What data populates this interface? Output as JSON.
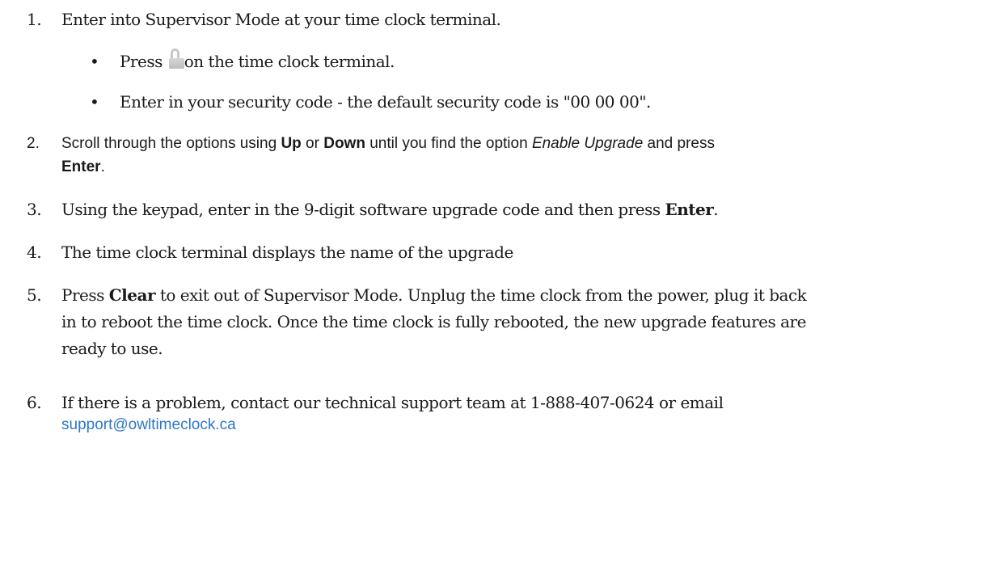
{
  "steps": [
    {
      "number": "1.",
      "text": "Enter into Supervisor Mode at your time clock terminal.",
      "bullets": [
        {
          "marker": "•",
          "before": "Press ",
          "icon": "lock-icon",
          "after": "on the time clock terminal."
        },
        {
          "marker": "•",
          "text": "Enter in your security code - the default security code is \"00 00 00\"."
        }
      ]
    },
    {
      "number": "2.",
      "t1": "Scroll through the options using ",
      "b1": "Up",
      "t2": " or ",
      "b2": "Down",
      "t3": " until you find the option ",
      "i1": "Enable Upgrade",
      "t4": " and press",
      "b3": "Enter",
      "t5": "."
    },
    {
      "number": "3.",
      "t1": "Using the keypad, enter in the 9-digit software upgrade code and then press ",
      "b1": "Enter",
      "t2": "."
    },
    {
      "number": "4.",
      "text": "The time clock terminal displays the name of the upgrade"
    },
    {
      "number": "5.",
      "t1": "Press ",
      "b1": "Clear",
      "line1_rest": " to exit out of Supervisor Mode.  Unplug the time clock from the power,  plug it back",
      "line2": "in to reboot the time clock. Once the time clock is fully rebooted, the new  upgrade features are",
      "line3": "ready to use."
    },
    {
      "number": "6.",
      "text": "If there is a problem, contact our technical support team at 1-888-407-0624 or email",
      "email": "support@owltimeclock.ca"
    }
  ]
}
